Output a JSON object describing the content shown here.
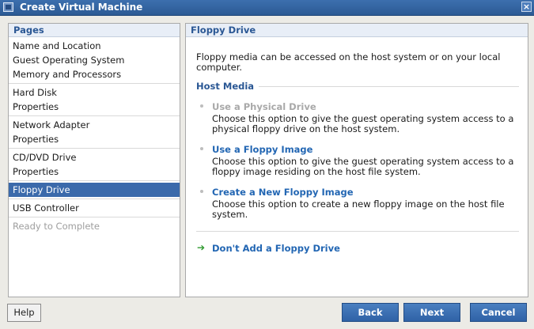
{
  "window": {
    "title": "Create Virtual Machine",
    "close_label": "×"
  },
  "sidebar": {
    "header": "Pages",
    "groups": [
      {
        "items": [
          {
            "label": "Name and Location"
          },
          {
            "label": "Guest Operating System"
          },
          {
            "label": "Memory and Processors"
          }
        ]
      },
      {
        "items": [
          {
            "label": "Hard Disk"
          },
          {
            "label": "Properties"
          }
        ]
      },
      {
        "items": [
          {
            "label": "Network Adapter"
          },
          {
            "label": "Properties"
          }
        ]
      },
      {
        "items": [
          {
            "label": "CD/DVD Drive"
          },
          {
            "label": "Properties"
          }
        ]
      },
      {
        "items": [
          {
            "label": "Floppy Drive",
            "selected": true
          }
        ]
      },
      {
        "items": [
          {
            "label": "USB Controller"
          }
        ]
      },
      {
        "items": [
          {
            "label": "Ready to Complete",
            "disabled": true
          }
        ]
      }
    ]
  },
  "content": {
    "header": "Floppy Drive",
    "intro": "Floppy media can be accessed on the host system or on your local computer.",
    "section_title": "Host Media",
    "options": [
      {
        "label": "Use a Physical Drive",
        "disabled": true,
        "description": "Choose this option to give the guest operating system access to a physical floppy drive on the host system."
      },
      {
        "label": "Use a Floppy Image",
        "disabled": false,
        "description": "Choose this option to give the guest operating system access to a floppy image residing on the host file system."
      },
      {
        "label": "Create a New Floppy Image",
        "disabled": false,
        "description": "Choose this option to create a new floppy image on the host file system."
      }
    ],
    "dont_add": {
      "arrow": "➔",
      "label": "Don't Add a Floppy Drive"
    }
  },
  "footer": {
    "help": "Help",
    "back": "Back",
    "next": "Next",
    "cancel": "Cancel"
  }
}
